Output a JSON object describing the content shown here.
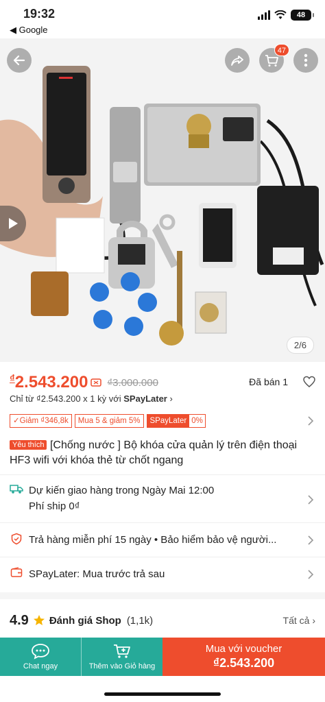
{
  "status_bar": {
    "time": "19:32",
    "back_app": "◀ Google",
    "battery": "48"
  },
  "hero": {
    "cart_count": "47",
    "image_counter": "2/6"
  },
  "price": {
    "currency": "₫",
    "current": "2.543.200",
    "original": "₫3.000.000",
    "sold": "Đã bán 1",
    "installment_prefix": "Chỉ từ ₫2.543.200 x 1 kỳ với ",
    "installment_brand": "SPayLater"
  },
  "tags": {
    "discount": "✓Giảm ₫346,8k",
    "promo": "Mua 5 & giảm 5%",
    "spay_a": "SPayLater",
    "spay_b": "0%"
  },
  "product": {
    "fav_label": "Yêu thích",
    "title": "[Chống nước ] Bộ khóa cửa quản lý trên điện thoại HF3 wifi với khóa thẻ từ chốt ngang"
  },
  "shipping": {
    "line1": "Dự kiến giao hàng trong Ngày Mai 12:00",
    "line2": "Phí ship 0₫"
  },
  "returns": {
    "text": "Trả hàng miễn phí 15 ngày  •  Bảo hiểm bảo vệ người..."
  },
  "spaylater": {
    "text": "SPayLater: Mua trước trả sau"
  },
  "rating": {
    "score": "4.9",
    "label": "Đánh giá Shop",
    "count": "(1,1k)",
    "all": "Tất cả"
  },
  "bottom_bar": {
    "chat": "Chat ngay",
    "cart": "Thêm vào Giỏ hàng",
    "buy_line1": "Mua với voucher",
    "buy_line2": "₫2.543.200"
  },
  "colors": {
    "accent": "#ee4d2d",
    "teal": "#26aa99"
  }
}
